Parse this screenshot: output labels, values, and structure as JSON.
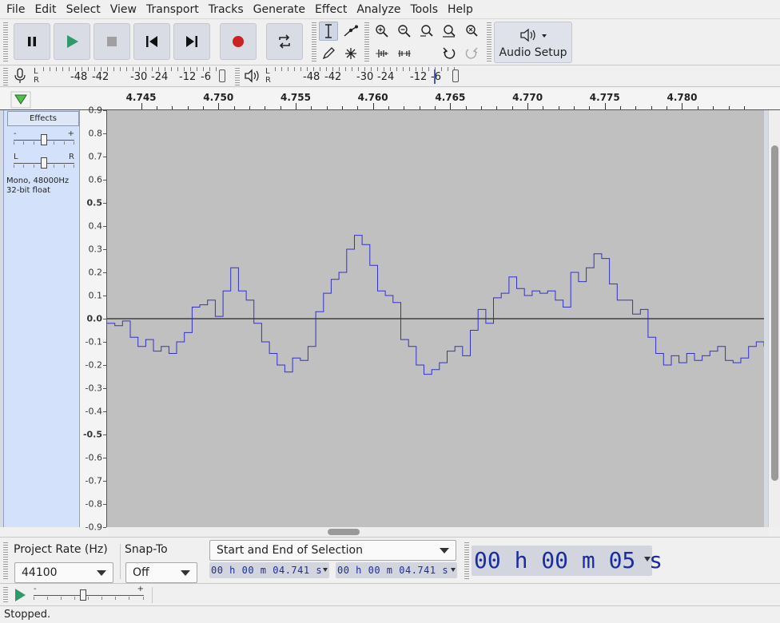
{
  "menu": [
    "File",
    "Edit",
    "Select",
    "View",
    "Transport",
    "Tracks",
    "Generate",
    "Effect",
    "Analyze",
    "Tools",
    "Help"
  ],
  "toolbar": {
    "audio_setup_label": "Audio Setup"
  },
  "meters": {
    "record": {
      "channels": [
        "L",
        "R"
      ],
      "scale": [
        "-48",
        "-42",
        "-30",
        "-24",
        "-12",
        "-6"
      ]
    },
    "playback": {
      "channels": [
        "L",
        "R"
      ],
      "scale": [
        "-48",
        "-42",
        "-30",
        "-24",
        "-12",
        "-6"
      ]
    }
  },
  "ruler": {
    "ticks": [
      "4.745",
      "4.750",
      "4.755",
      "4.760",
      "4.765",
      "4.770",
      "4.775",
      "4.780"
    ]
  },
  "track": {
    "effects_label": "Effects",
    "gain_min": "-",
    "gain_max": "+",
    "pan_left": "L",
    "pan_right": "R",
    "info_line1": "Mono, 48000Hz",
    "info_line2": "32-bit float",
    "gain_level": 0.5,
    "pan_level": 0.5
  },
  "vertical_ruler": {
    "labels": [
      {
        "text": "0.9",
        "v": 0.9,
        "bold": false
      },
      {
        "text": "0.8",
        "v": 0.8,
        "bold": false
      },
      {
        "text": "0.7",
        "v": 0.7,
        "bold": false
      },
      {
        "text": "0.6",
        "v": 0.6,
        "bold": false
      },
      {
        "text": "0.5",
        "v": 0.5,
        "bold": true
      },
      {
        "text": "0.4",
        "v": 0.4,
        "bold": false
      },
      {
        "text": "0.3",
        "v": 0.3,
        "bold": false
      },
      {
        "text": "0.2",
        "v": 0.2,
        "bold": false
      },
      {
        "text": "0.1",
        "v": 0.1,
        "bold": false
      },
      {
        "text": "0.0",
        "v": 0.0,
        "bold": true
      },
      {
        "text": "-0.1",
        "v": -0.1,
        "bold": false
      },
      {
        "text": "-0.2",
        "v": -0.2,
        "bold": false
      },
      {
        "text": "-0.3",
        "v": -0.3,
        "bold": false
      },
      {
        "text": "-0.4",
        "v": -0.4,
        "bold": false
      },
      {
        "text": "-0.5",
        "v": -0.5,
        "bold": true
      },
      {
        "text": "-0.6",
        "v": -0.6,
        "bold": false
      },
      {
        "text": "-0.7",
        "v": -0.7,
        "bold": false
      },
      {
        "text": "-0.8",
        "v": -0.8,
        "bold": false
      },
      {
        "text": "-0.9",
        "v": -0.9,
        "bold": false
      }
    ]
  },
  "waveform": {
    "t": [
      4.7428,
      4.7433,
      4.7438,
      4.7443,
      4.7448,
      4.7453,
      4.7458,
      4.7463,
      4.7468,
      4.7473,
      4.7478,
      4.7483,
      4.7488,
      4.7493,
      4.7498,
      4.7503,
      4.7508,
      4.7513,
      4.7518,
      4.7523,
      4.7528,
      4.7533,
      4.7538,
      4.7543,
      4.7548,
      4.7553,
      4.7558,
      4.7563,
      4.7568,
      4.7573,
      4.7578,
      4.7583,
      4.7588,
      4.7593,
      4.7598,
      4.7603,
      4.7608,
      4.7613,
      4.7618,
      4.7623,
      4.7628,
      4.7633,
      4.7638,
      4.7643,
      4.7648,
      4.7653,
      4.7658,
      4.7663,
      4.7668,
      4.7673,
      4.7678,
      4.7683,
      4.7688,
      4.7693,
      4.7698,
      4.7703,
      4.7708,
      4.7713,
      4.7718,
      4.7723,
      4.7728,
      4.7733,
      4.7738,
      4.7743,
      4.7748,
      4.7753,
      4.7758,
      4.7763,
      4.7768,
      4.7773,
      4.7778,
      4.7783,
      4.7788,
      4.7793,
      4.7798,
      4.7803,
      4.7808,
      4.7813,
      4.7818,
      4.7823,
      4.7828,
      4.7833,
      4.7838,
      4.7843,
      4.7848,
      4.7853
    ],
    "v": [
      -0.02,
      -0.03,
      -0.01,
      -0.08,
      -0.12,
      -0.09,
      -0.14,
      -0.12,
      -0.15,
      -0.1,
      -0.06,
      0.05,
      0.06,
      0.08,
      0.01,
      0.12,
      0.22,
      0.12,
      0.08,
      -0.02,
      -0.1,
      -0.15,
      -0.2,
      -0.23,
      -0.17,
      -0.18,
      -0.12,
      0.03,
      0.11,
      0.17,
      0.2,
      0.3,
      0.36,
      0.32,
      0.23,
      0.12,
      0.1,
      0.07,
      -0.09,
      -0.12,
      -0.2,
      -0.24,
      -0.22,
      -0.19,
      -0.14,
      -0.12,
      -0.16,
      -0.05,
      0.04,
      -0.02,
      0.09,
      0.11,
      0.18,
      0.13,
      0.1,
      0.12,
      0.11,
      0.12,
      0.08,
      0.05,
      0.2,
      0.16,
      0.22,
      0.28,
      0.26,
      0.15,
      0.08,
      0.08,
      0.02,
      0.04,
      -0.08,
      -0.15,
      -0.2,
      -0.16,
      -0.19,
      -0.15,
      -0.18,
      -0.16,
      -0.14,
      -0.12,
      -0.18,
      -0.19,
      -0.17,
      -0.12,
      -0.1,
      -0.12
    ],
    "xlim": [
      4.7428,
      4.7853
    ],
    "ylim": [
      -0.9,
      0.9
    ],
    "line_color": "#3232c8",
    "background_color": "#c0c0c0"
  },
  "selection_bar": {
    "project_rate_label": "Project Rate (Hz)",
    "project_rate_value": "44100",
    "snap_to_label": "Snap-To",
    "snap_to_value": "Off",
    "selection_mode": "Start and End of Selection",
    "start_time": "00 h 00 m 04.741 s",
    "end_time": "00 h 00 m 04.741 s",
    "audio_position": "00 h 00 m 05 s"
  },
  "play_at_speed": {
    "min": "-",
    "max": "+",
    "speed_level": 0.45
  },
  "status": "Stopped.",
  "colors": {
    "accent": "#1a2ca0",
    "track_panel": "#d3e2fa",
    "record": "#cc2222",
    "play": "#2e9a6a"
  }
}
